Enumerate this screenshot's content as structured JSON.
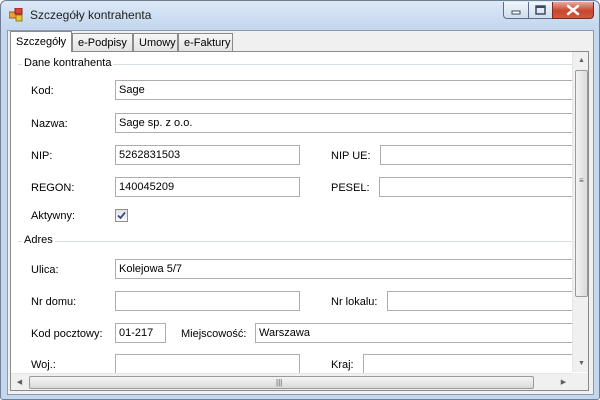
{
  "window": {
    "title": "Szczegóły kontrahenta",
    "icon": "app-form-icon"
  },
  "tabs": [
    {
      "label": "Szczegóły",
      "active": true
    },
    {
      "label": "e-Podpisy",
      "active": false
    },
    {
      "label": "Umowy",
      "active": false
    },
    {
      "label": "e-Faktury",
      "active": false
    }
  ],
  "dane": {
    "caption": "Dane kontrahenta",
    "kod": {
      "label": "Kod:",
      "value": "Sage"
    },
    "nazwa": {
      "label": "Nazwa:",
      "value": "Sage sp. z o.o."
    },
    "nip": {
      "label": "NIP:",
      "value": "5262831503"
    },
    "nip_ue": {
      "label": "NIP UE:",
      "value": ""
    },
    "regon": {
      "label": "REGON:",
      "value": "140045209"
    },
    "pesel": {
      "label": "PESEL:",
      "value": ""
    },
    "aktywny": {
      "label": "Aktywny:",
      "checked": true
    }
  },
  "adres": {
    "caption": "Adres",
    "ulica": {
      "label": "Ulica:",
      "value": "Kolejowa 5/7"
    },
    "nr_domu": {
      "label": "Nr domu:",
      "value": ""
    },
    "nr_lokalu": {
      "label": "Nr lokalu:",
      "value": ""
    },
    "kod_pocztowy": {
      "label": "Kod pocztowy:",
      "value": "01-217"
    },
    "miejscowosc": {
      "label": "Miejscowość:",
      "value": "Warszawa"
    },
    "woj": {
      "label": "Woj.:",
      "value": ""
    },
    "kraj": {
      "label": "Kraj:",
      "value": ""
    }
  },
  "colors": {
    "title_bar": "#c4d7ee",
    "close_button": "#c7462f",
    "checkbox_mark": "#3a4e8c"
  }
}
